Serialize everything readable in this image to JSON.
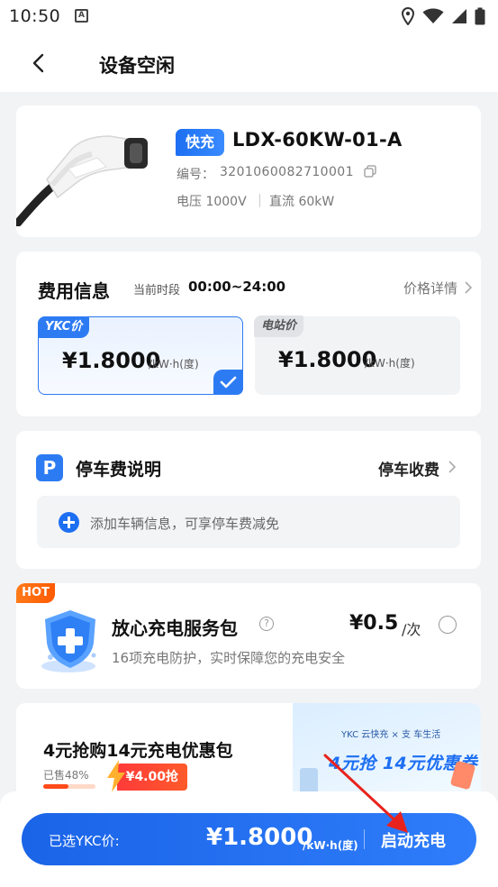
{
  "status_bar": {
    "time": "10:50",
    "notif_letter": "A"
  },
  "nav": {
    "title": "设备空闲"
  },
  "device": {
    "badge": "快充",
    "model": "LDX-60KW-01-A",
    "serial_label": "编号：",
    "serial": "3201060082710001",
    "voltage": "电压 1000V",
    "current": "直流 60kW"
  },
  "fee": {
    "title": "费用信息",
    "period_label": "当前时段",
    "period": "00:00~24:00",
    "detail_link": "价格详情",
    "ykc": {
      "tag": "YKC价",
      "price": "¥1.8000",
      "unit": "/kW·h(度)"
    },
    "station": {
      "tag": "电站价",
      "price": "¥1.8000",
      "unit": "/kW·h(度)"
    }
  },
  "parking": {
    "icon_letter": "P",
    "title": "停车费说明",
    "fee_type": "停车收费",
    "add_text": "添加车辆信息，可享停车费减免"
  },
  "service": {
    "hot": "HOT",
    "title": "放心充电服务包",
    "price": "¥0.5",
    "per": "/次",
    "desc": "16项充电防护，实时保障您的充电安全"
  },
  "promo": {
    "title": "4元抢购14元充电优惠包",
    "sold": "已售48%",
    "sold_fraction": 0.48,
    "button": "¥4.00抢",
    "banner_brands": "YKC 云快充 × 支 车生活",
    "banner_slogan": "4元抢 14元优惠券"
  },
  "bottom": {
    "selected_label": "已选YKC价:",
    "price": "¥1.8000",
    "unit": "/kW·h(度)",
    "start": "启动充电"
  },
  "colors": {
    "primary": "#1d6ff2",
    "hot": "#ff6a00",
    "promo_red": "#ff3a3a"
  }
}
